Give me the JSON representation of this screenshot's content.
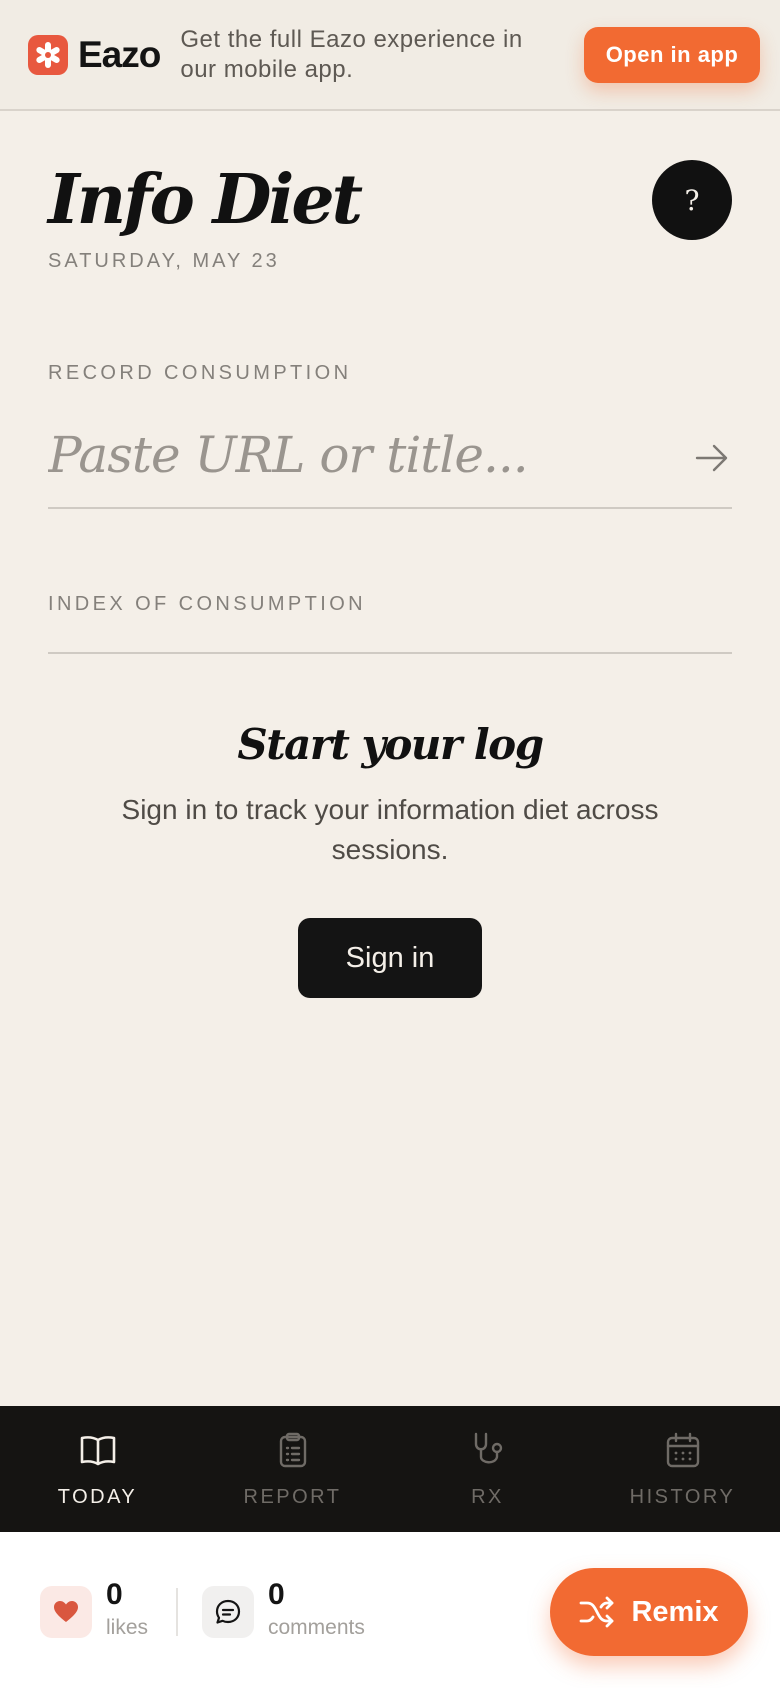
{
  "banner": {
    "brand_name": "Eazo",
    "message": "Get the full Eazo experience in our mobile app.",
    "open_app_label": "Open in app"
  },
  "header": {
    "title": "Info Diet",
    "date": "SATURDAY, MAY 23",
    "help_label": "?"
  },
  "record": {
    "label": "RECORD CONSUMPTION",
    "placeholder": "Paste URL or title...",
    "value": ""
  },
  "index": {
    "label": "INDEX OF CONSUMPTION"
  },
  "empty_state": {
    "title": "Start your log",
    "description": "Sign in to track your information diet across sessions.",
    "signin_label": "Sign in"
  },
  "tabs": [
    {
      "label": "TODAY",
      "icon": "book-open-icon",
      "active": true
    },
    {
      "label": "REPORT",
      "icon": "clipboard-list-icon",
      "active": false
    },
    {
      "label": "RX",
      "icon": "stethoscope-icon",
      "active": false
    },
    {
      "label": "HISTORY",
      "icon": "calendar-icon",
      "active": false
    }
  ],
  "social": {
    "likes_count": "0",
    "likes_label": "likes",
    "comments_count": "0",
    "comments_label": "comments",
    "remix_label": "Remix"
  },
  "colors": {
    "accent": "#f26a32",
    "background": "#f4efe8",
    "dark": "#141414",
    "brand_mark": "#e8583f"
  }
}
